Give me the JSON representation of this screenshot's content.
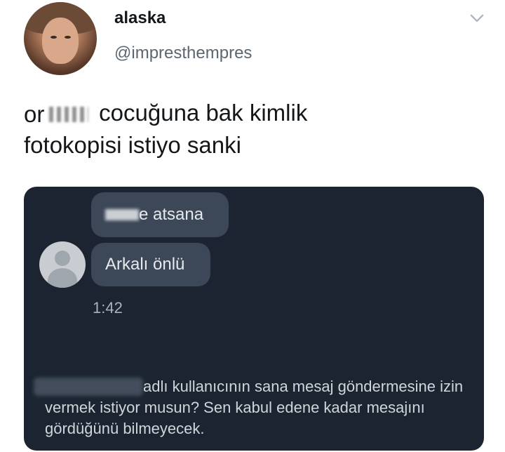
{
  "author": {
    "display_name": "alaska",
    "handle": "@impresthempres"
  },
  "tweet": {
    "text_visible_prefix": "or",
    "text_rest_line1": " cocuğuna bak kimlik",
    "text_line2": "fotokopisi istiyo sanki"
  },
  "dm_screenshot": {
    "bubble_1_suffix": "e atsana",
    "bubble_2": "Arkalı önlü",
    "timestamp": "1:42",
    "request_text": "adlı kullanıcının sana mesaj göndermesine izin vermek istiyor musun? Sen kabul edene kadar mesajını gördüğünü bilmeyecek."
  },
  "icons": {
    "caret": "chevron-down-icon",
    "contact": "default-avatar-icon"
  },
  "colors": {
    "dm_background": "#1b2430",
    "bubble": "#3c4757",
    "handle_gray": "#5b6670"
  }
}
